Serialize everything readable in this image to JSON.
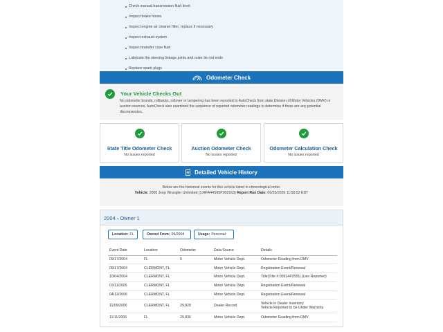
{
  "maintenance": {
    "items": [
      "Check manual transmission fluid level.",
      "Inspect brake hoses",
      "Inspect engine air cleaner filter, replace if necessary",
      "Inspect exhaust system",
      "Inspect transfer case fluid",
      "Lubricate the steering linkage joints and outer tie rod ends",
      "Replace spark plugs"
    ]
  },
  "odometer": {
    "section_title": "Odometer Check",
    "checks_out_title": "Your Vehicle Checks Out",
    "checks_out_text": "No odometer brands, rollbacks, rollover or tampering has been reported to AutoCheck from state Division of Motor Vehicles (DMV) or auction sources. AutoCheck also examined the sequence of reported odometer readings to determine if there are any potential discrepancies.",
    "cards": [
      {
        "title": "State Title Odometer Check",
        "status": "No issues reported"
      },
      {
        "title": "Auction Odometer Check",
        "status": "No issues reported"
      },
      {
        "title": "Odometer Calculation Check",
        "status": "No issues reported"
      }
    ],
    "accent_color": "#1c72bb",
    "ok_color": "#1e9c3c"
  },
  "history": {
    "section_title": "Detailed Vehicle History",
    "intro": "Below are the historical events for this vehicle listed in chronological order.",
    "vehicle_label": "Vehicle:",
    "vehicle_value": "2005 Jeep Wrangler Unlimited (1J4FA44S95P302163)",
    "run_date_label": "Report Run Date:",
    "run_date_value": "06/23/2026 11:58:52 EDT"
  },
  "owner": {
    "title": "2004 - Owner  1",
    "location_label": "Location:",
    "location_value": "FL",
    "owned_from_label": "Owned From:",
    "owned_from_value": "09/2004",
    "usage_label": "Usage:",
    "usage_value": "Personal",
    "columns": [
      "Event Date",
      "Location",
      "Odometer",
      "Data Source",
      "Details"
    ],
    "rows": [
      {
        "date": "09/17/2004",
        "location": "FL",
        "odometer": "5",
        "source": "Motor Vehicle Dept.",
        "details": "Odometer Reading from DMV",
        "details2": ""
      },
      {
        "date": "09/17/2004",
        "location": "CLERMONT, FL",
        "odometer": "",
        "source": "Motor Vehicle Dept.",
        "details": "Registration Event/Renewal",
        "details2": ""
      },
      {
        "date": "10/04/2004",
        "location": "CLERMONT, FL",
        "odometer": "",
        "source": "Motor Vehicle Dept.",
        "details": "Title(Title #:0091447835) (Lien Reported)",
        "details2": ""
      },
      {
        "date": "03/11/2005",
        "location": "CLERMONT, FL",
        "odometer": "",
        "source": "Motor Vehicle Dept.",
        "details": "Registration Event/Renewal",
        "details2": ""
      },
      {
        "date": "04/12/2006",
        "location": "CLERMONT, FL",
        "odometer": "",
        "source": "Motor Vehicle Dept.",
        "details": "Registration Event/Renewal",
        "details2": ""
      },
      {
        "date": "11/09/2006",
        "location": "CLERMONT, FL",
        "odometer": "29,820",
        "source": "Dealer Record",
        "details": "Vehicle in Dealer Inventory",
        "details2": "Vehicle Reported to be Under Warranty"
      },
      {
        "date": "11/11/2006",
        "location": "FL",
        "odometer": "29,836",
        "source": "Motor Vehicle Dept.",
        "details": "Odometer Reading from DMV",
        "details2": ""
      }
    ]
  }
}
